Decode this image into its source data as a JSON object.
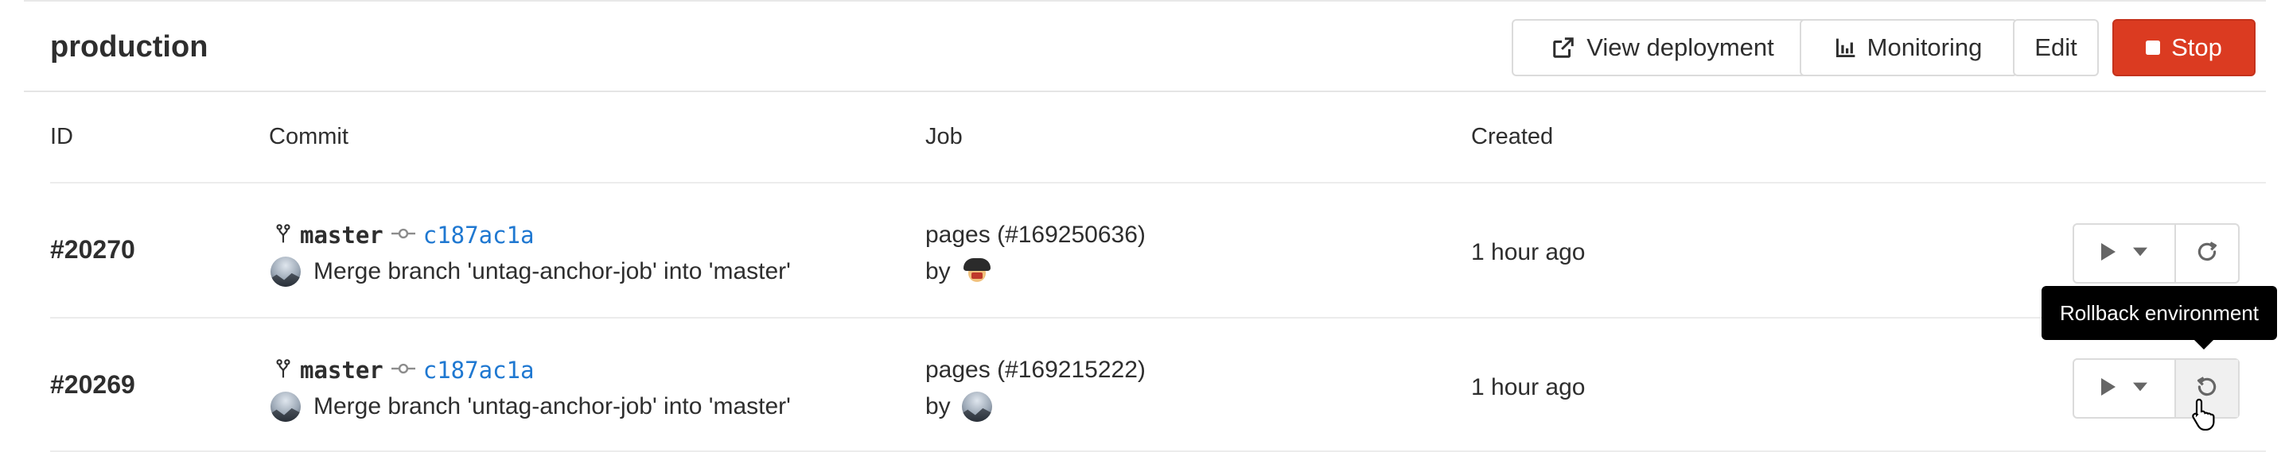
{
  "environment": {
    "name": "production",
    "buttons": {
      "view_deployment": "View deployment",
      "monitoring": "Monitoring",
      "edit": "Edit",
      "stop": "Stop"
    }
  },
  "table": {
    "headers": {
      "id": "ID",
      "commit": "Commit",
      "job": "Job",
      "created": "Created"
    },
    "rows": [
      {
        "id": "#20270",
        "branch": "master",
        "sha": "c187ac1a",
        "message": "Merge branch 'untag-anchor-job' into 'master'",
        "job": "pages (#169250636)",
        "by": "by",
        "created": "1 hour ago",
        "action_icon": "retry-icon"
      },
      {
        "id": "#20269",
        "branch": "master",
        "sha": "c187ac1a",
        "message": "Merge branch 'untag-anchor-job' into 'master'",
        "job": "pages (#169215222)",
        "by": "by",
        "created": "1 hour ago",
        "action_icon": "rollback-icon"
      }
    ]
  },
  "tooltip": {
    "text": "Rollback environment"
  },
  "colors": {
    "stop": "#db3b21",
    "link": "#1f78d1",
    "text": "#2e2e2e",
    "border": "#dbdbdb"
  }
}
